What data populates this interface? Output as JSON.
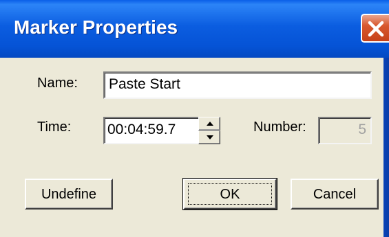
{
  "window": {
    "title": "Marker Properties",
    "close_icon": "close-x-icon"
  },
  "form": {
    "name_label": "Name:",
    "name_value": "Paste Start",
    "time_label": "Time:",
    "time_value": "00:04:59.7",
    "number_label": "Number:",
    "number_value": "5"
  },
  "buttons": {
    "undefine_label": "Undefine",
    "ok_label": "OK",
    "cancel_label": "Cancel"
  },
  "colors": {
    "titlebar_blue": "#0553D6",
    "dialog_bg": "#ECE9D8",
    "close_red": "#D8582E"
  }
}
